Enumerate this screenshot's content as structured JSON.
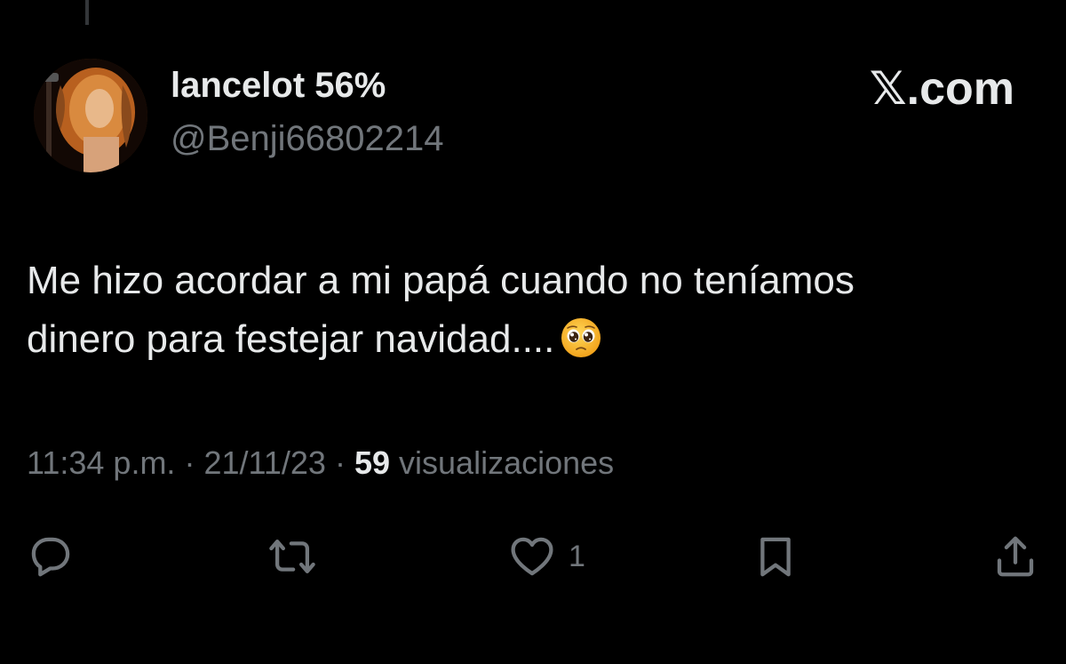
{
  "author": {
    "display_name": "lancelot 56%",
    "handle": "@Benji66802214"
  },
  "brand": {
    "label": "𝕏.com"
  },
  "tweet": {
    "text_line1": "Me hizo acordar a mi papá cuando no teníamos",
    "text_line2": "dinero para festejar navidad....",
    "emoji": "pleading-face-emoji"
  },
  "meta": {
    "time": "11:34 p.m.",
    "separator": "·",
    "date": "21/11/23",
    "views_count": "59",
    "views_label": "visualizaciones"
  },
  "actions": {
    "reply_icon": "reply-icon",
    "repost_icon": "repost-icon",
    "like_icon": "heart-icon",
    "like_count": "1",
    "bookmark_icon": "bookmark-icon",
    "share_icon": "share-icon"
  },
  "colors": {
    "background": "#000000",
    "primary_text": "#e7e9ea",
    "secondary_text": "#71767b"
  }
}
